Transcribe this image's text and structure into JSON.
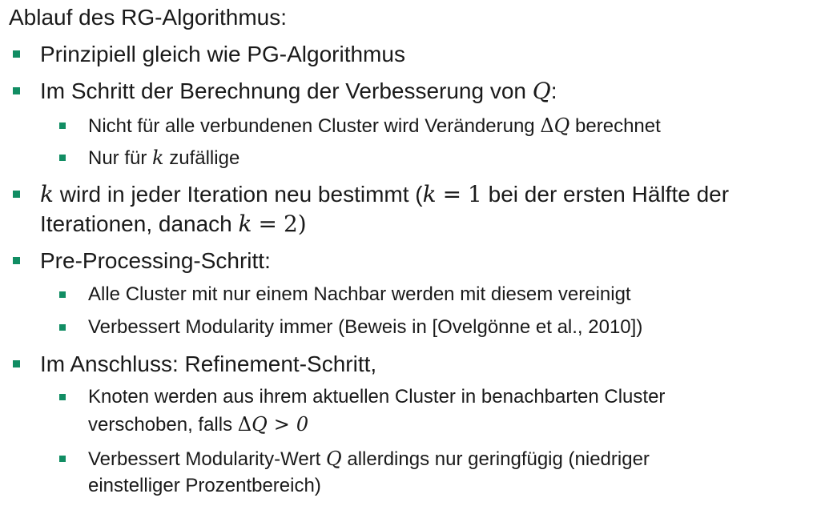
{
  "slide": {
    "heading": "Ablauf des RG-Algorithmus:",
    "items": [
      {
        "text": "Prinzipiell gleich wie PG-Algorithmus"
      },
      {
        "pre": "Im Schritt der Berechnung der Verbesserung von ",
        "math": "Q",
        "post": ":"
      },
      {
        "pre": "Nicht für alle verbundenen Cluster wird Veränderung ",
        "math_delta": "Δ",
        "math": "Q",
        "post": " berechnet"
      },
      {
        "pre": "Nur für ",
        "math": "k",
        "post": " zufällige"
      },
      {
        "math_k": "k",
        "part1": " wird in jeder Iteration neu bestimmt (",
        "math_k2": "k",
        "eq1": "=",
        "num1": "1",
        "part2": " bei der ersten Hälfte der",
        "line2_pre": "Iterationen, danach ",
        "math_k3": "k",
        "eq2": "=",
        "num2": "2",
        "line2_post": ")"
      },
      {
        "text": "Pre-Processing-Schritt:"
      },
      {
        "text": "Alle Cluster mit nur einem Nachbar werden mit diesem vereinigt"
      },
      {
        "text": "Verbessert Modularity immer (Beweis in [Ovelgönne et al., 2010])"
      },
      {
        "text": "Im Anschluss: Refinement-Schritt,"
      },
      {
        "line1": "Knoten werden aus ihrem aktuellen Cluster in benachbarten Cluster",
        "line2_pre": "verschoben, falls ",
        "math_delta": "Δ",
        "math": "Q",
        "gt": ">",
        "zero": "0"
      },
      {
        "line1_pre": "Verbessert Modularity-Wert ",
        "math": "Q",
        "line1_post": " allerdings nur geringfügig (niedriger",
        "line2": "einstelliger Prozentbereich)"
      }
    ]
  },
  "colors": {
    "bullet": "#118d63",
    "text": "#1a1a1a",
    "background": "#ffffff"
  }
}
